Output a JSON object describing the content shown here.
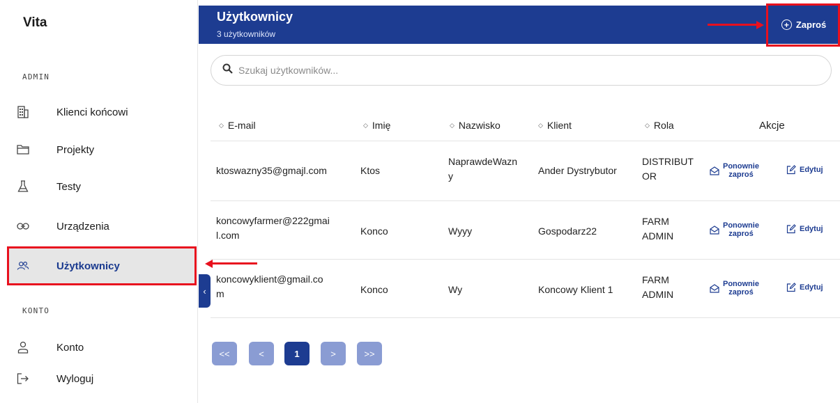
{
  "app": {
    "brand": "Vita"
  },
  "sidebar": {
    "section_admin": "ADMIN",
    "section_account": "KONTO",
    "items": [
      {
        "label": "Klienci końcowi",
        "icon": "building-icon"
      },
      {
        "label": "Projekty",
        "icon": "folder-icon"
      },
      {
        "label": "Testy",
        "icon": "flask-icon"
      },
      {
        "label": "Urządzenia",
        "icon": "link-icon"
      },
      {
        "label": "Użytkownicy",
        "icon": "users-icon",
        "active": true
      },
      {
        "label": "Konto",
        "icon": "user-icon"
      },
      {
        "label": "Wyloguj",
        "icon": "logout-icon"
      }
    ],
    "collapse_glyph": "‹"
  },
  "header": {
    "title": "Użytkownicy",
    "subtitle": "3 użytkowników",
    "invite_label": "Zaproś"
  },
  "search": {
    "placeholder": "Szukaj użytkowników..."
  },
  "table": {
    "columns": [
      "E-mail",
      "Imię",
      "Nazwisko",
      "Klient",
      "Rola",
      "Akcje"
    ],
    "rows": [
      {
        "email": [
          "ktoswazny35@gmajl.com"
        ],
        "first": "Ktos",
        "last": [
          "NaprawdeWazn",
          "y"
        ],
        "client": "Ander Dystrybutor",
        "role": [
          "DISTRIBUT",
          "OR"
        ]
      },
      {
        "email": [
          "koncowyfarmer@222gmai",
          "l.com"
        ],
        "first": "Konco",
        "last": [
          "Wyyy"
        ],
        "client": "Gospodarz22",
        "role": [
          "FARM",
          "ADMIN"
        ]
      },
      {
        "email": [
          "koncowyklient@gmail.co",
          "m"
        ],
        "first": "Konco",
        "last": [
          "Wy"
        ],
        "client": "Koncowy Klient 1",
        "role": [
          "FARM",
          "ADMIN"
        ]
      }
    ],
    "actions": {
      "reinvite_line1": "Ponownie",
      "reinvite_line2": "zaproś",
      "edit": "Edytuj"
    }
  },
  "pagination": {
    "first": "<<",
    "prev": "<",
    "current": "1",
    "next": ">",
    "last": ">>"
  },
  "colors": {
    "primary": "#1d3c91",
    "pagination_inactive": "#8a9cd3",
    "annotation_red": "#e8101e",
    "active_bg": "#e6e6e6"
  }
}
